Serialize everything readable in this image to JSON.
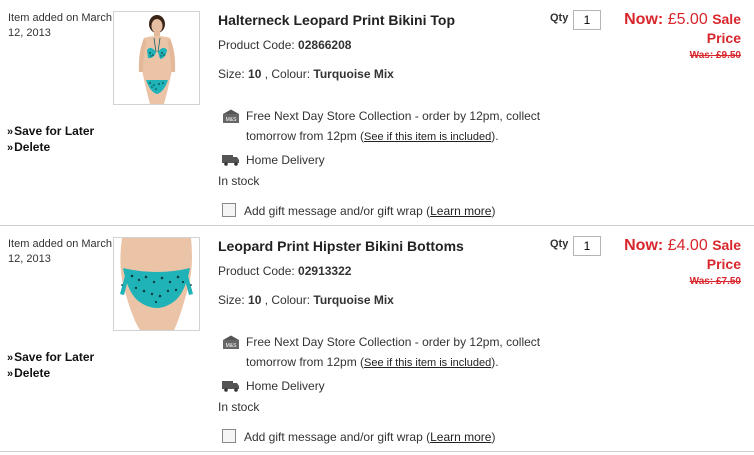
{
  "basket": {
    "qty_label": "Qty",
    "now_label": "Now:",
    "sale_line1": "Sale",
    "sale_line2": "Price",
    "store_collection_line1": "Free Next Day Store Collection - order by 12pm, collect",
    "store_collection_line2": "tomorrow from 12pm (",
    "store_collection_link": "See if this item is included",
    "store_collection_end": ").",
    "home_delivery": "Home Delivery",
    "stock": "In stock",
    "gift_label": "Add gift message and/or gift wrap (",
    "gift_link": "Learn more",
    "gift_end": ")",
    "save_label": "Save for Later",
    "delete_label": "Delete",
    "store_logo_text": "M&S",
    "icons": {
      "store": "store-icon",
      "delivery": "delivery-van-icon",
      "checkbox": "checkbox-icon"
    },
    "colors": {
      "price": "#d8262d",
      "text": "#333333"
    },
    "items": [
      {
        "added": "Item added on March 12, 2013",
        "title": "Halterneck Leopard Print Bikini Top",
        "code_label": "Product Code: ",
        "code": "02866208",
        "size_label": "Size: ",
        "size": "10",
        "colour_label": " , Colour: ",
        "colour": "Turquoise Mix",
        "qty": "1",
        "now": "£5.00",
        "was": "Was: £9.50"
      },
      {
        "added": "Item added on March 12, 2013",
        "title": "Leopard Print Hipster Bikini Bottoms",
        "code_label": "Product Code: ",
        "code": "02913322",
        "size_label": "Size: ",
        "size": "10",
        "colour_label": " , Colour: ",
        "colour": "Turquoise Mix",
        "qty": "1",
        "now": "£4.00",
        "was": "Was: £7.50"
      }
    ]
  }
}
